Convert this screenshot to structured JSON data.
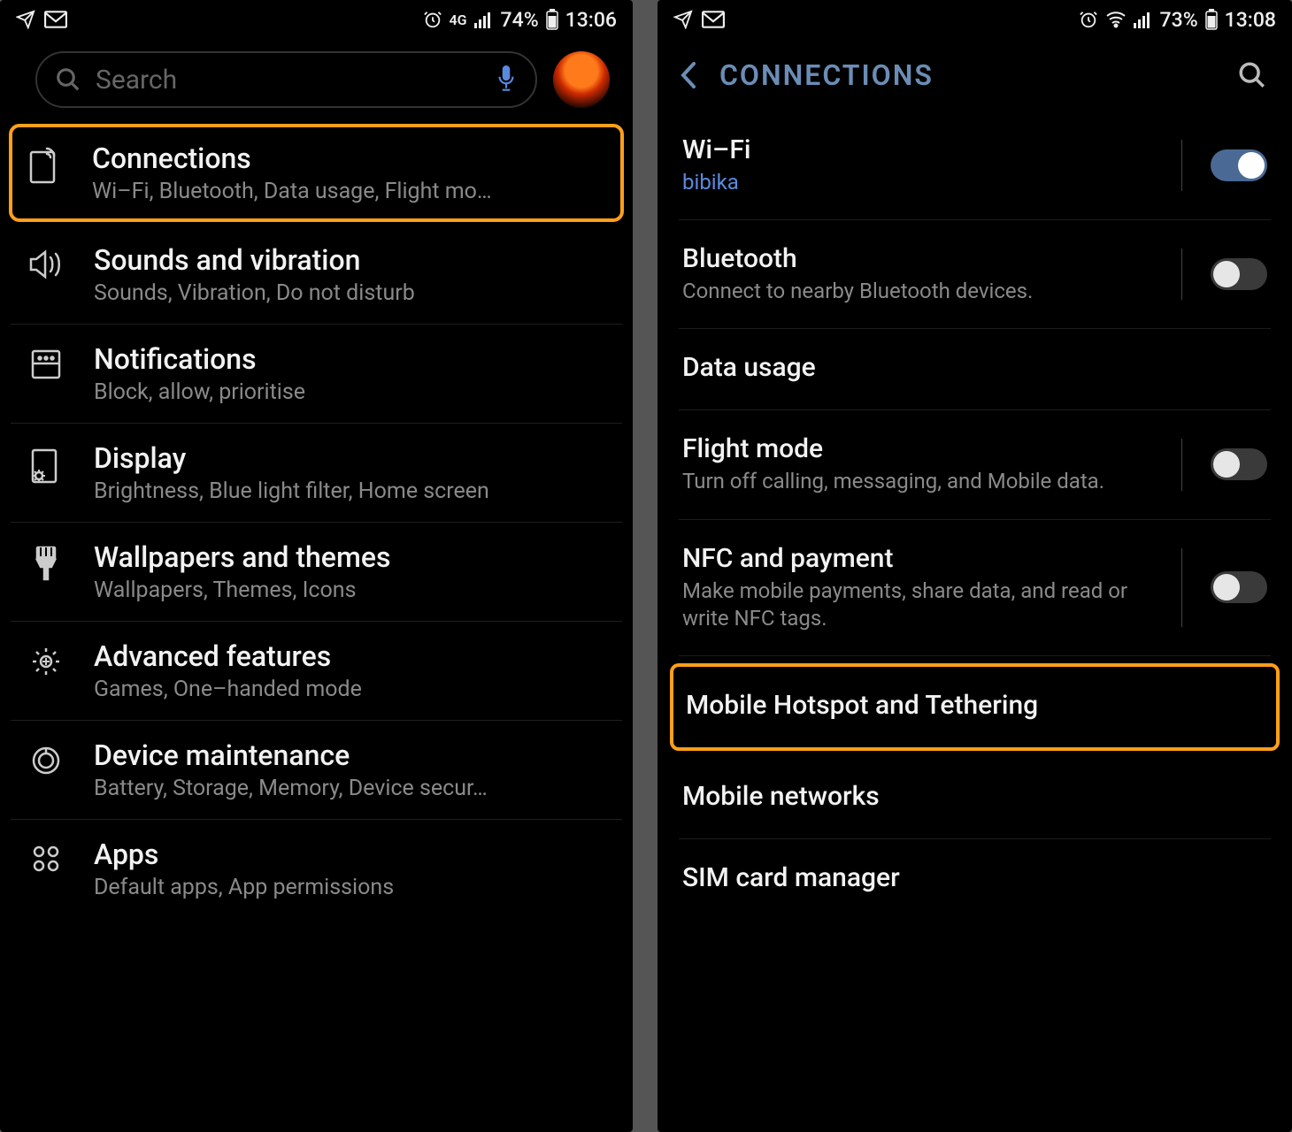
{
  "left": {
    "status": {
      "network_label": "4G",
      "battery": "74%",
      "time": "13:06"
    },
    "search_placeholder": "Search",
    "items": [
      {
        "title": "Connections",
        "sub": "Wi–Fi, Bluetooth, Data usage, Flight mo…",
        "highlight": true
      },
      {
        "title": "Sounds and vibration",
        "sub": "Sounds, Vibration, Do not disturb"
      },
      {
        "title": "Notifications",
        "sub": "Block, allow, prioritise"
      },
      {
        "title": "Display",
        "sub": "Brightness, Blue light filter, Home screen"
      },
      {
        "title": "Wallpapers and themes",
        "sub": "Wallpapers, Themes, Icons"
      },
      {
        "title": "Advanced features",
        "sub": "Games, One–handed mode"
      },
      {
        "title": "Device maintenance",
        "sub": "Battery, Storage, Memory, Device secur…"
      },
      {
        "title": "Apps",
        "sub": "Default apps, App permissions"
      }
    ]
  },
  "right": {
    "status": {
      "battery": "73%",
      "time": "13:08"
    },
    "header_title": "CONNECTIONS",
    "rows": [
      {
        "title": "Wi–Fi",
        "sub": "bibika",
        "sub_link": true,
        "toggle": true,
        "on": true
      },
      {
        "title": "Bluetooth",
        "sub": "Connect to nearby Bluetooth devices.",
        "toggle": true,
        "on": false
      },
      {
        "title": "Data usage",
        "sub": ""
      },
      {
        "title": "Flight mode",
        "sub": "Turn off calling, messaging, and Mobile data.",
        "toggle": true,
        "on": false
      },
      {
        "title": "NFC and payment",
        "sub": "Make mobile payments, share data, and read or write NFC tags.",
        "toggle": true,
        "on": false
      },
      {
        "title": "Mobile Hotspot and Tethering",
        "sub": "",
        "highlight": true
      },
      {
        "title": "Mobile networks",
        "sub": ""
      },
      {
        "title": "SIM card manager",
        "sub": ""
      }
    ]
  }
}
